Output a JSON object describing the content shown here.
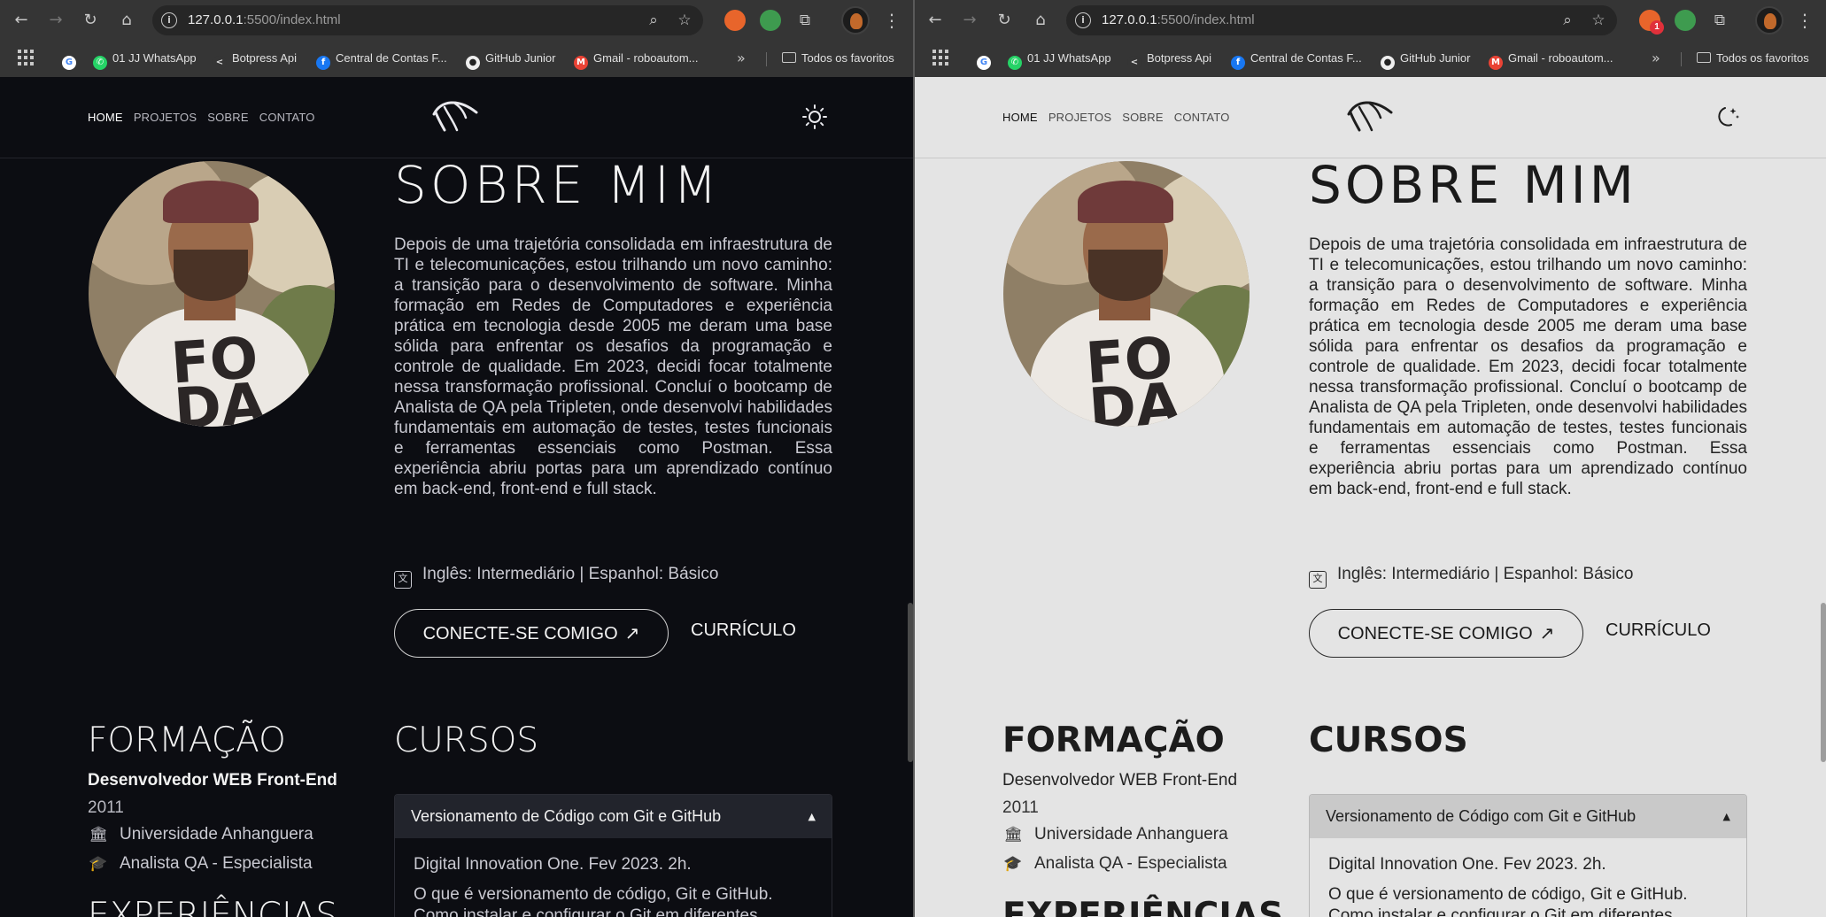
{
  "browser": {
    "url_host": "127.0.0.1",
    "url_path": ":5500/index.html",
    "bookmarks": [
      {
        "label": "01 JJ WhatsApp"
      },
      {
        "label": "Botpress Api"
      },
      {
        "label": "Central de Contas F..."
      },
      {
        "label": "GitHub Junior"
      },
      {
        "label": "Gmail - roboautom..."
      }
    ],
    "all_bookmarks_label": "Todos os favoritos",
    "notification_badge": "1",
    "icons": {
      "back": "arrow-left-icon",
      "forward": "arrow-right-icon",
      "reload": "reload-icon",
      "home": "home-icon",
      "site_info": "site-info-icon",
      "zoom": "zoom-icon",
      "bookmark": "star-icon",
      "extensions": "puzzle-icon",
      "menu": "kebab-menu-icon",
      "apps": "apps-grid-icon",
      "more": "chevron-double-right-icon",
      "folder": "folder-icon"
    }
  },
  "site": {
    "nav": [
      {
        "label": "HOME"
      },
      {
        "label": "PROJETOS"
      },
      {
        "label": "SOBRE"
      },
      {
        "label": "CONTATO"
      }
    ],
    "title": "SOBRE MIM",
    "bio": "Depois de uma trajetória consolidada em infraestrutura de TI e telecomunicações, estou trilhando um novo caminho: a transição para o desenvolvimento de software. Minha formação em Redes de Computadores e experiência prática em tecnologia desde 2005 me deram uma base sólida para enfrentar os desafios da programação e controle de qualidade. Em 2023, decidi focar totalmente nessa transformação profissional. Concluí o bootcamp de Analista de QA pela Tripleten, onde desenvolvi habilidades fundamentais em automação de testes, testes funcionais e ferramentas essenciais como Postman. Essa experiência abriu portas para um aprendizado contínuo em back-end, front-end e full stack.",
    "languages": "Inglês: Intermediário | Espanhol: Básico",
    "connect_label": "CONECTE-SE COMIGO",
    "connect_arrow": "↗",
    "cv_label": "CURRÍCULO",
    "education_title": "FORMAÇÃO",
    "degree": "Desenvolvedor WEB Front-End",
    "year": "2011",
    "university": "Universidade Anhanguera",
    "role": "Analista QA - Especialista",
    "experience_title": "EXPERIÊNCIAS",
    "courses_title": "CURSOS",
    "course": {
      "title": "Versionamento de Código com Git e GitHub",
      "meta": "Digital Innovation One. Fev 2023. 2h.",
      "description": "O que é versionamento de código, Git e GitHub. Como instalar e configurar o Git em diferentes"
    },
    "icons": {
      "logo": "bird-logo-icon",
      "theme_dark_window": "sun-icon",
      "theme_light_window": "moon-stars-icon",
      "language": "translate-icon",
      "university": "institution-icon",
      "role": "graduation-cap-icon",
      "caret": "caret-up-icon"
    },
    "colors": {
      "dark_bg": "#0c0d12",
      "light_bg": "#e4e4e4",
      "dark_text": "#e9e9ee",
      "light_text": "#1e1e1e"
    }
  }
}
